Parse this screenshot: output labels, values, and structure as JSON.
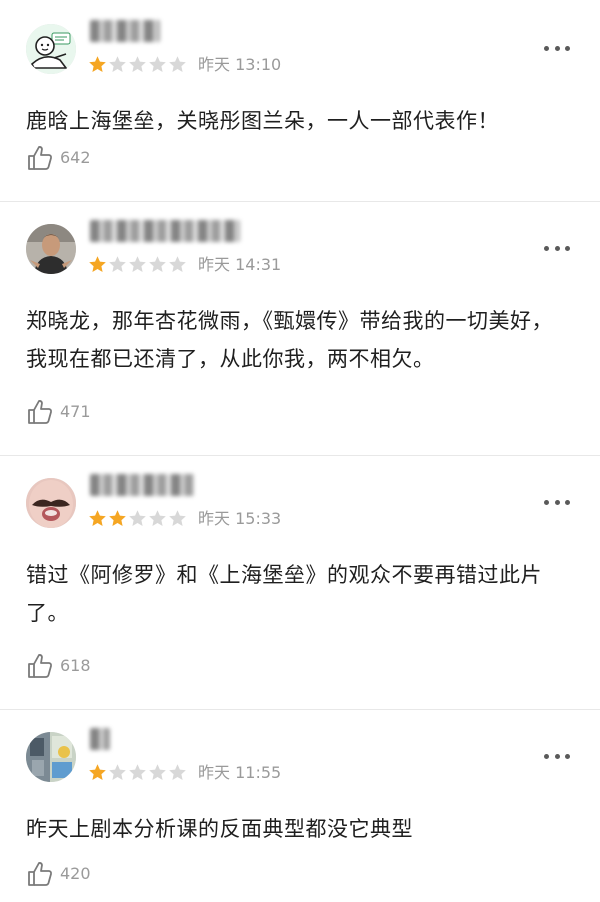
{
  "reviews": [
    {
      "rating": 1,
      "max_rating": 5,
      "time": "昨天 13:10",
      "content": "鹿晗上海堡垒，关晓彤图兰朵，一人一部代表作！",
      "likes": "642",
      "avatar_icon": "cartoon-avatar-icon"
    },
    {
      "rating": 1,
      "max_rating": 5,
      "time": "昨天 14:31",
      "content": "郑晓龙，那年杏花微雨，《甄嬛传》带给我的一切美好，我现在都已还清了，从此你我，两不相欠。",
      "likes": "471",
      "avatar_icon": "person-photo-avatar-icon"
    },
    {
      "rating": 2,
      "max_rating": 5,
      "time": "昨天 15:33",
      "content": "错过《阿修罗》和《上海堡垒》的观众不要再错过此片了。",
      "likes": "618",
      "avatar_icon": "mustache-face-avatar-icon"
    },
    {
      "rating": 1,
      "max_rating": 5,
      "time": "昨天 11:55",
      "content": "昨天上剧本分析课的反面典型都没它典型",
      "likes": "420",
      "avatar_icon": "collage-avatar-icon"
    }
  ],
  "colors": {
    "star_filled": "#f5a623",
    "star_empty": "#d8d8d8",
    "meta_text": "#9a9a9a",
    "divider": "#e8e8e8"
  }
}
